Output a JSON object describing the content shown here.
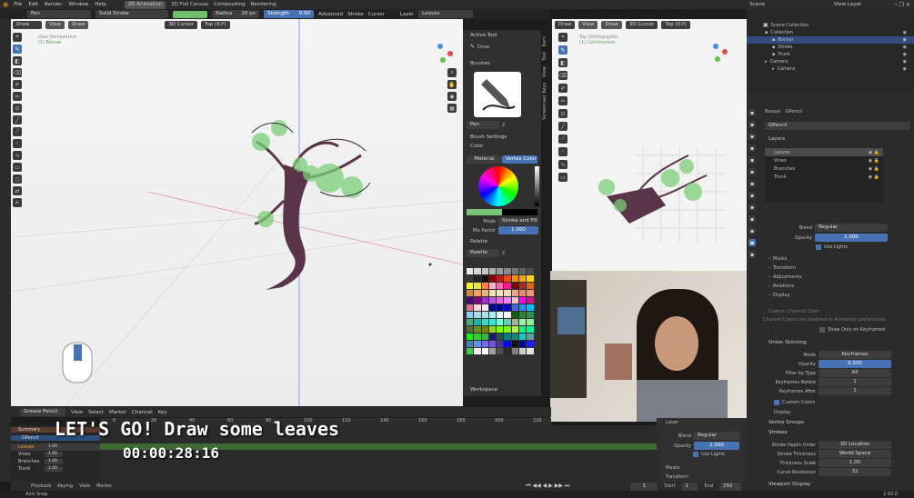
{
  "topbar": {
    "menus": [
      "File",
      "Edit",
      "Render",
      "Window",
      "Help"
    ],
    "workspaces": [
      "2D Animation",
      "2D Full Canvas",
      "Compositing",
      "Rendering"
    ],
    "brush": "Pen",
    "stroke_mode": "Solid Stroke",
    "radius_label": "Radius",
    "radius_value": "26 px",
    "strength_label": "Strength",
    "strength_value": "0.90",
    "advanced": "Advanced",
    "stroke": "Stroke",
    "cursor": "Cursor",
    "layer_label": "Layer",
    "layer_value": "Leaves",
    "scene_label": "Scene",
    "view_layer_label": "View Layer"
  },
  "viewport_left": {
    "mode": "Draw",
    "view": "View",
    "draw": "Draw",
    "cursor": "3D Cursor",
    "orient": "Top (X-Y)",
    "title": "User Perspective",
    "subtitle": "(1) Bonsai"
  },
  "tool_panel": {
    "tabs": [
      "Item",
      "Tool",
      "View",
      "Screencast Keys"
    ],
    "active_tool": "Active Tool",
    "draw": "Draw",
    "brushes": "Brushes",
    "brush_name": "Pen",
    "brush_count": "2",
    "brush_settings": "Brush Settings",
    "color": "Color",
    "material_tab": "Material",
    "vertex_tab": "Vertex Color",
    "mode_label": "Mode",
    "mode_value": "Stroke and Fill",
    "mix_label": "Mix Factor",
    "mix_value": "1.000",
    "palette_section": "Palette",
    "palette_name": "Palette",
    "palette_count": "2",
    "workspace": "Workspace",
    "colors": [
      "#e8e8e8",
      "#d6d6d6",
      "#c4c4c4",
      "#b0b0b0",
      "#9c9c9c",
      "#888888",
      "#747474",
      "#606060",
      "#4c4c4c",
      "#383838",
      "#242424",
      "#101010",
      "#8b0000",
      "#b22222",
      "#ff4500",
      "#ff8c00",
      "#ffa500",
      "#ffd700",
      "#ffff00",
      "#e5e54a",
      "#ff7f50",
      "#ffb6c1",
      "#ff69b4",
      "#ff1493",
      "#800000",
      "#a52a2a",
      "#d2691e",
      "#cd853f",
      "#f4a460",
      "#deb887",
      "#f5deb3",
      "#ffe4c4",
      "#ffdab9",
      "#ffa07a",
      "#fa8072",
      "#e9967a",
      "#4b0082",
      "#800080",
      "#9932cc",
      "#ba55d3",
      "#da70d6",
      "#ee82ee",
      "#ffc0cb",
      "#ff00ff",
      "#c71585",
      "#db7093",
      "#ffd1dc",
      "#fce4ec",
      "#000080",
      "#00008b",
      "#0000cd",
      "#4169e1",
      "#1e90ff",
      "#00bfff",
      "#87cefa",
      "#add8e6",
      "#b0e0e6",
      "#afeeee",
      "#e0ffff",
      "#f0ffff",
      "#006400",
      "#228b22",
      "#2e8b57",
      "#3cb371",
      "#20b2aa",
      "#48d1cc",
      "#40e0d0",
      "#7fffd4",
      "#66cdaa",
      "#8fbc8f",
      "#98fb98",
      "#90ee90",
      "#556b2f",
      "#6b8e23",
      "#808000",
      "#9acd32",
      "#7cfc00",
      "#7fff00",
      "#adff2f",
      "#00ff7f",
      "#00fa9a",
      "#00ff00",
      "#32cd32",
      "#3cb043",
      "#191970",
      "#2f4f4f",
      "#008080",
      "#008b8b",
      "#00ced1",
      "#5f9ea0",
      "#4682b4",
      "#6495ed",
      "#7b68ee",
      "#6a5acd",
      "#483d8b",
      "#0000ff",
      "#111111",
      "#0000aa",
      "#1b1bff",
      "#3ad24b",
      "#f0f0f0",
      "#ffffff",
      "#a0a0a0",
      "#505050",
      "#2a2a2a",
      "#7f7f7f",
      "#cccccc",
      "#e6e6e6"
    ]
  },
  "viewport_right": {
    "view": "View",
    "draw": "Draw",
    "mode": "Draw",
    "cursor": "3D Cursor",
    "orient": "Top (X-Y)",
    "stroke_mode": "Solid Stroke",
    "title": "Top Orthographic",
    "subtitle": "(1) Centimeters"
  },
  "outliner": {
    "title": "Scene Collection",
    "items": [
      {
        "name": "Collection",
        "indent": 1
      },
      {
        "name": "Bonsai",
        "indent": 2
      },
      {
        "name": "Stroke",
        "indent": 2
      },
      {
        "name": "Trunk",
        "indent": 2
      },
      {
        "name": "Camera",
        "indent": 1
      },
      {
        "name": "Camera",
        "indent": 2
      }
    ]
  },
  "properties": {
    "object_name": "Bonsai",
    "data_name": "GPencil",
    "data_field": "GPencil",
    "layers_title": "Layers",
    "layers": [
      "Leaves",
      "Vines",
      "Branches",
      "Trunk"
    ],
    "blend_label": "Blend",
    "blend_value": "Regular",
    "opacity_label": "Opacity",
    "opacity_value": "1.000",
    "use_lights": "Use Lights",
    "sections": [
      "Masks",
      "Transform",
      "Adjustments",
      "Relations",
      "Display"
    ],
    "custom_channel": "Custom Channel Color",
    "channel_note": "Channel Colors are disabled in Animation preferences",
    "show_only": "Show Only on Keyframed",
    "onion": "Onion Skinning",
    "onion_mode_label": "Mode",
    "onion_mode_value": "Keyframes",
    "onion_opacity_label": "Opacity",
    "onion_opacity_value": "0.500",
    "filter_label": "Filter by Type",
    "filter_value": "All",
    "kf_before_label": "Keyframes Before",
    "kf_before_value": "1",
    "kf_after_label": "Keyframes After",
    "kf_after_value": "1",
    "custom_colors": "Custom Colors",
    "display2": "Display",
    "vertex_groups": "Vertex Groups",
    "strokes": "Strokes",
    "depth_label": "Stroke Depth Order",
    "depth_value": "3D Location",
    "thick_label": "Stroke Thickness",
    "thick_value": "World Space",
    "thick_scale_label": "Thickness Scale",
    "thick_scale_value": "1.00",
    "curve_label": "Curve Resolution",
    "curve_value": "32",
    "viewport_display": "Viewport Display"
  },
  "timeline": {
    "editor": "Grease Pencil",
    "menus": [
      "View",
      "Select",
      "Marker",
      "Channel",
      "Key"
    ],
    "summary": "Summary",
    "object": "GPencil",
    "tracks": [
      {
        "name": "Leaves",
        "val": "1.00"
      },
      {
        "name": "Vines",
        "val": "1.00"
      },
      {
        "name": "Branches",
        "val": "1.00"
      },
      {
        "name": "Trunk",
        "val": "1.00"
      }
    ],
    "ruler": [
      "0",
      "20",
      "40",
      "60",
      "80",
      "100",
      "120",
      "140",
      "160",
      "180",
      "200",
      "220"
    ],
    "layer_panel": "Layer",
    "blend_label": "Blend",
    "blend_value": "Regular",
    "opacity_label": "Opacity",
    "opacity_value": "1.000",
    "use_lights": "Use Lights",
    "masks": "Masks",
    "transform": "Transform"
  },
  "playback": {
    "items": [
      "Playback",
      "Keying",
      "View",
      "Marker"
    ],
    "frame": "1",
    "start_label": "Start",
    "start": "1",
    "end_label": "End",
    "end": "250"
  },
  "overlay": {
    "caption": "LET'S GO! Draw some leaves",
    "timer": "00:00:28:16"
  },
  "status": {
    "left": "Axis Snap",
    "version": "2.93.0"
  },
  "palette_accent": "#4772b3"
}
